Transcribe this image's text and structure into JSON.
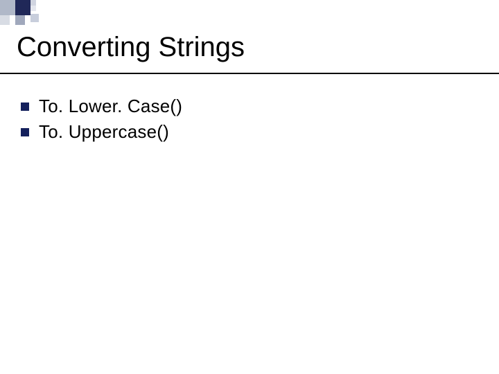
{
  "slide": {
    "title": "Converting Strings",
    "bullets": [
      {
        "text": "To. Lower. Case()"
      },
      {
        "text": "To. Uppercase()"
      }
    ]
  }
}
